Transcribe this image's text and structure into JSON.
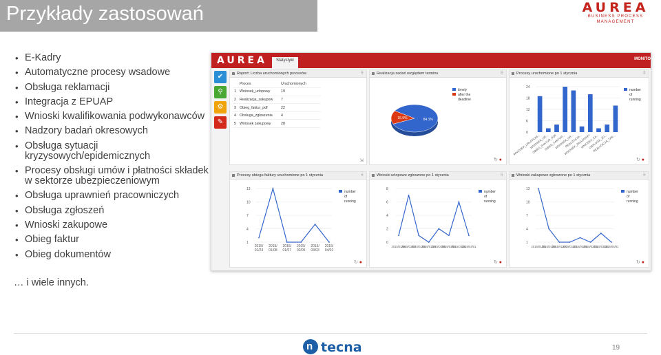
{
  "slide": {
    "title": "Przykłady zastosowań",
    "logo_word": "AUREA",
    "logo_tagline": "BUSINESS PROCESS MANAGEMENT",
    "bullets": [
      "E-Kadry",
      "Automatyczne procesy wsadowe",
      "Obsługa reklamacji",
      "Integracja z EPUAP",
      "Wnioski kwalifikowania podwykonawców",
      "Nadzory badań okresowych",
      "Obsługa sytuacji kryzysowych/epidemicznych",
      "Procesy obsługi umów i płatności składek w sektorze ubezpieczeniowym",
      "Obsługa uprawnień pracowniczych",
      "Obsługa zgłoszeń",
      "Wnioski zakupowe",
      "Obieg faktur",
      "Obieg dokumentów"
    ],
    "more": "… i wiele innych.",
    "footer_brand": "tecna",
    "page_number": "19"
  },
  "dashboard": {
    "brand": "AUREA",
    "tab": "Statystyki",
    "topright": "MONITO",
    "sidebar_icons": [
      "check-icon",
      "tree-icon",
      "gear-icon",
      "edit-icon"
    ],
    "report_table": {
      "title": "Raport: Liczba uruchomionych procesów",
      "headers": [
        "Proces",
        "Uruchomionych"
      ],
      "rows": [
        {
          "n": "1",
          "name": "Wniosek_urlopowy",
          "count": "19"
        },
        {
          "n": "2",
          "name": "Realizacja_zakupow",
          "count": "7"
        },
        {
          "n": "3",
          "name": "Obieg_faktur_pdf",
          "count": "22"
        },
        {
          "n": "4",
          "name": "Obsluga_zgloszenia",
          "count": "4"
        },
        {
          "n": "5",
          "name": "Wniosek zakupowy",
          "count": "28"
        }
      ]
    },
    "colors": {
      "brand": "#c0201f",
      "blue": "#3366cc",
      "red": "#dc3912"
    }
  },
  "chart_data": [
    {
      "type": "pie",
      "title": "Realizacja zadań względem terminu",
      "labels": [
        "timely",
        "after the deadline"
      ],
      "values": [
        84.1,
        15.9
      ],
      "slice_labels": [
        "84.1%",
        "15.9%"
      ],
      "legend_position": "right"
    },
    {
      "type": "bar",
      "title": "Procesy uruchomione po 1 stycznia",
      "series": [
        {
          "name": "number of running",
          "values": [
            19,
            2,
            4,
            24,
            22,
            3,
            20,
            2,
            4,
            14
          ]
        }
      ],
      "categories": [
        "WNIOSEK_URLOPOW...",
        "WNIOSEK_UR...",
        "OBIEG_FAKTUR_PDF",
        "OBIEG_FAKTUR...",
        "WNIOSEK_UR...",
        "REALIZACJA...",
        "WNIOSEK_ZAKUPOWY",
        "WNIOSEK_ZA...",
        "OBSLUGA_ZG...",
        "REALIZACJA_ZAK..."
      ],
      "yticks": [
        "24",
        "18",
        "12",
        "6",
        "0"
      ],
      "ylim": [
        0,
        24
      ],
      "legend_position": "right"
    },
    {
      "type": "line",
      "title": "Procesy obiegu faktury uruchomione po 1 stycznia",
      "series": [
        {
          "name": "number of running",
          "values": [
            2,
            13,
            1,
            1,
            5,
            1
          ]
        }
      ],
      "categories": [
        "2015/01/23",
        "2015/01/08",
        "2015/01/07",
        "2015/02/05",
        "2015/03/03",
        "2015/04/01"
      ],
      "yticks": [
        "13",
        "10",
        "7",
        "4",
        "1"
      ],
      "ylim": [
        1,
        13
      ],
      "legend_position": "right"
    },
    {
      "type": "line",
      "title": "Wnioski urlopowe zgłoszone po 1 stycznia",
      "series": [
        {
          "name": "number of running",
          "values": [
            1,
            7,
            1,
            0,
            2,
            1,
            6,
            1
          ]
        }
      ],
      "categories": [
        "2015/01/06",
        "2015/01/07",
        "2015/01/28",
        "2015/01/29",
        "2015/02/05",
        "2015/03/03",
        "2015/03/31",
        "2015/04/01"
      ],
      "yticks": [
        "8",
        "6",
        "4",
        "2",
        "0"
      ],
      "ylim": [
        0,
        8
      ],
      "legend_position": "right"
    },
    {
      "type": "line",
      "title": "Wnioski zakupowe zgłoszone po 1 stycznia",
      "series": [
        {
          "name": "number of running",
          "values": [
            13,
            4,
            1,
            1,
            2,
            1,
            3,
            1
          ]
        }
      ],
      "categories": [
        "2015/01/25",
        "2015/01/06",
        "2015/01/07",
        "2015/01/28",
        "2015/02/06",
        "2015/03/03",
        "2015/03/30",
        "2015/04/01"
      ],
      "yticks": [
        "13",
        "10",
        "7",
        "4",
        "1"
      ],
      "ylim": [
        1,
        13
      ],
      "legend_position": "right"
    }
  ]
}
